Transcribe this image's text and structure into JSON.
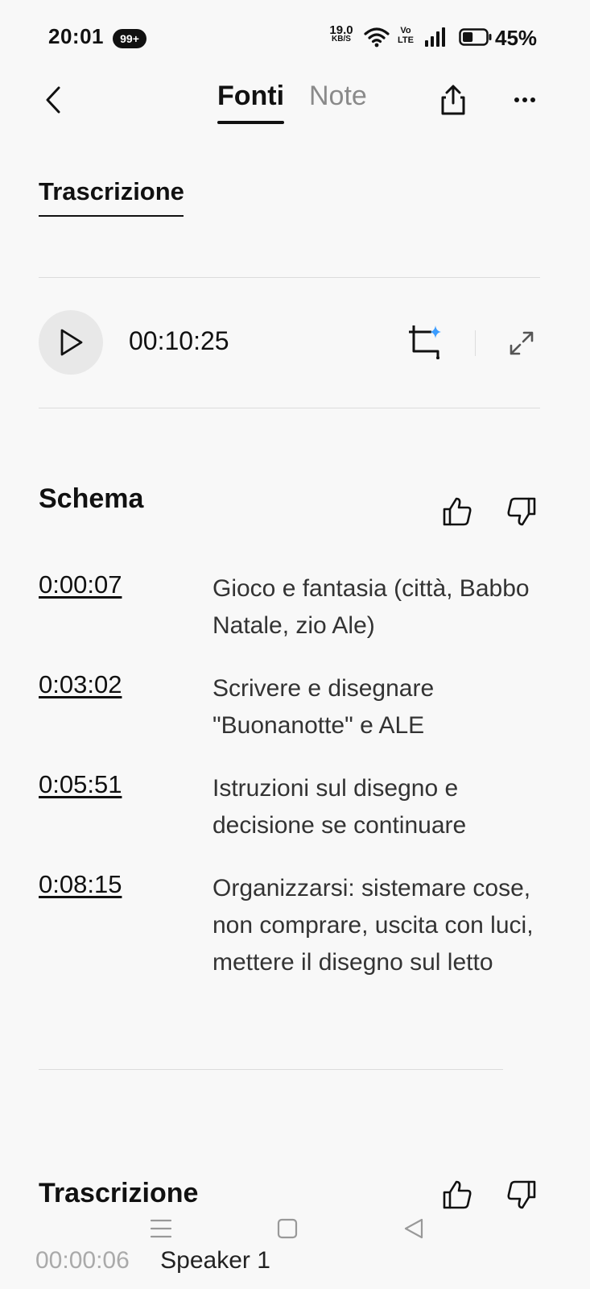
{
  "status_bar": {
    "time": "20:01",
    "notification_badge": "99+",
    "net_speed_value": "19.0",
    "net_speed_unit": "KB/S",
    "volte_top": "Vo",
    "volte_bottom": "LTE",
    "battery_percent": "45%",
    "battery_level": 0.45
  },
  "header": {
    "tabs": [
      {
        "label": "Fonti",
        "active": true
      },
      {
        "label": "Note",
        "active": false
      }
    ],
    "back_icon": "chevron-left-icon",
    "share_icon": "share-icon",
    "more_icon": "more-horizontal-icon"
  },
  "subtab": {
    "label": "Trascrizione"
  },
  "audio": {
    "duration": "00:10:25",
    "play_icon": "play-icon",
    "crop_icon": "crop-sparkle-icon",
    "expand_icon": "expand-icon"
  },
  "outline": {
    "title": "Schema",
    "items": [
      {
        "time": "0:00:07",
        "text": "Gioco e fantasia (città, Babbo Natale, zio Ale)"
      },
      {
        "time": "0:03:02",
        "text": "Scrivere e disegnare \"Buonanotte\" e ALE"
      },
      {
        "time": "0:05:51",
        "text": "Istruzioni sul disegno e decisione se continuare"
      },
      {
        "time": "0:08:15",
        "text": "Organizzarsi: sistemare cose, non comprare, uscita con luci, mettere il disegno sul letto"
      }
    ]
  },
  "transcript": {
    "title": "Trascrizione",
    "first_time": "00:00:06",
    "first_speaker": "Speaker 1"
  },
  "colors": {
    "background": "#f8f8f8",
    "text": "#111111",
    "muted": "#8a8a8a",
    "accent_sparkle": "#3b9cff"
  }
}
